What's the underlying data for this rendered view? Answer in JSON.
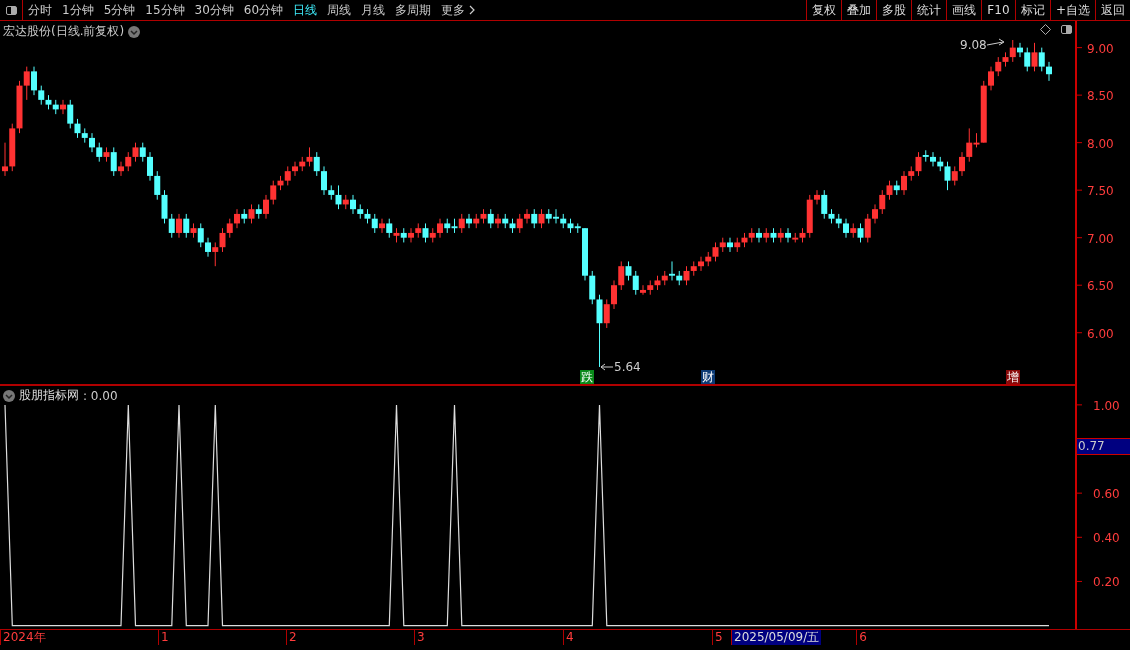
{
  "toolbar": {
    "periods": [
      {
        "label": "分时",
        "selected": false
      },
      {
        "label": "1分钟",
        "selected": false
      },
      {
        "label": "5分钟",
        "selected": false
      },
      {
        "label": "15分钟",
        "selected": false
      },
      {
        "label": "30分钟",
        "selected": false
      },
      {
        "label": "60分钟",
        "selected": false
      },
      {
        "label": "日线",
        "selected": true
      },
      {
        "label": "周线",
        "selected": false
      },
      {
        "label": "月线",
        "selected": false
      },
      {
        "label": "多周期",
        "selected": false
      },
      {
        "label": "更多",
        "selected": false
      }
    ],
    "actions": [
      "复权",
      "叠加",
      "多股",
      "统计",
      "画线",
      "F10",
      "标记",
      "+自选",
      "返回"
    ]
  },
  "price_panel": {
    "title": "宏达股份(日线.前复权)",
    "high_label": "9.08",
    "low_label": "5.64",
    "markers": [
      {
        "label": "跌",
        "color": "#0a8a1a"
      },
      {
        "label": "财",
        "color": "#0c3a74"
      },
      {
        "label": "增",
        "color": "#8a0a0a"
      }
    ],
    "chart_data": {
      "type": "candlestick",
      "ylim": [
        5.45,
        9.28
      ],
      "categories": [
        null,
        null,
        null,
        null,
        null,
        null,
        null,
        null,
        null,
        null,
        null,
        null,
        null,
        null,
        null,
        null,
        null,
        null,
        null,
        null,
        null,
        null,
        null,
        null,
        null,
        null,
        null,
        null,
        null,
        null,
        null,
        null,
        null,
        null,
        null,
        null,
        null,
        null,
        null,
        null,
        null,
        null,
        null,
        null,
        null,
        null,
        null,
        null,
        null,
        null,
        null,
        null,
        null,
        null,
        null,
        null,
        null,
        null,
        null,
        null,
        null,
        null,
        null,
        null,
        null,
        null,
        null,
        null,
        null,
        null,
        null,
        null,
        null,
        null,
        null,
        null,
        null,
        null,
        null,
        null,
        null,
        null,
        null,
        null,
        null,
        null,
        null,
        null,
        null,
        null,
        null,
        null,
        null,
        null,
        null,
        null,
        null,
        null,
        null,
        null,
        null,
        null,
        null,
        null,
        null,
        null,
        null,
        null,
        null,
        null,
        null,
        null,
        null,
        null,
        null,
        null,
        null,
        null,
        null,
        null,
        null,
        null,
        null,
        null,
        null,
        null,
        null,
        null,
        null,
        null,
        null,
        null,
        null,
        null,
        null,
        null,
        null,
        null,
        null,
        null,
        null,
        null,
        null,
        null,
        null
      ],
      "yticks": [
        {
          "value": 9,
          "label": "9.00"
        },
        {
          "value": 8.5,
          "label": "8.50"
        },
        {
          "value": 8,
          "label": "8.00"
        },
        {
          "value": 7.5,
          "label": "7.50"
        },
        {
          "value": 7,
          "label": "7.00"
        },
        {
          "value": 6.5,
          "label": "6.50"
        },
        {
          "value": 6,
          "label": "6.00"
        }
      ],
      "ohlc": [
        [
          7.7,
          8.0,
          7.65,
          7.75
        ],
        [
          7.75,
          8.2,
          7.7,
          8.15
        ],
        [
          8.15,
          8.65,
          8.1,
          8.6
        ],
        [
          8.6,
          8.8,
          8.45,
          8.75
        ],
        [
          8.75,
          8.8,
          8.5,
          8.55
        ],
        [
          8.55,
          8.6,
          8.4,
          8.45
        ],
        [
          8.45,
          8.5,
          8.35,
          8.4
        ],
        [
          8.4,
          8.45,
          8.3,
          8.35
        ],
        [
          8.35,
          8.45,
          8.3,
          8.4
        ],
        [
          8.4,
          8.45,
          8.15,
          8.2
        ],
        [
          8.2,
          8.25,
          8.05,
          8.1
        ],
        [
          8.1,
          8.15,
          8.0,
          8.05
        ],
        [
          8.05,
          8.1,
          7.9,
          7.95
        ],
        [
          7.95,
          8.0,
          7.8,
          7.85
        ],
        [
          7.85,
          7.95,
          7.8,
          7.9
        ],
        [
          7.9,
          7.95,
          7.65,
          7.7
        ],
        [
          7.7,
          7.8,
          7.65,
          7.75
        ],
        [
          7.75,
          7.9,
          7.7,
          7.85
        ],
        [
          7.85,
          8.0,
          7.8,
          7.95
        ],
        [
          7.95,
          8.0,
          7.8,
          7.85
        ],
        [
          7.85,
          7.9,
          7.6,
          7.65
        ],
        [
          7.65,
          7.7,
          7.4,
          7.45
        ],
        [
          7.45,
          7.5,
          7.15,
          7.2
        ],
        [
          7.2,
          7.25,
          7.0,
          7.05
        ],
        [
          7.05,
          7.25,
          7.0,
          7.2
        ],
        [
          7.2,
          7.25,
          7.0,
          7.05
        ],
        [
          7.05,
          7.15,
          7.0,
          7.1
        ],
        [
          7.1,
          7.15,
          6.9,
          6.95
        ],
        [
          6.95,
          7.0,
          6.8,
          6.85
        ],
        [
          6.85,
          6.95,
          6.7,
          6.9
        ],
        [
          6.9,
          7.1,
          6.85,
          7.05
        ],
        [
          7.05,
          7.2,
          7.0,
          7.15
        ],
        [
          7.15,
          7.3,
          7.1,
          7.25
        ],
        [
          7.25,
          7.3,
          7.15,
          7.2
        ],
        [
          7.2,
          7.35,
          7.15,
          7.3
        ],
        [
          7.3,
          7.35,
          7.2,
          7.25
        ],
        [
          7.25,
          7.45,
          7.2,
          7.4
        ],
        [
          7.4,
          7.6,
          7.35,
          7.55
        ],
        [
          7.55,
          7.65,
          7.5,
          7.6
        ],
        [
          7.6,
          7.75,
          7.55,
          7.7
        ],
        [
          7.7,
          7.8,
          7.65,
          7.75
        ],
        [
          7.75,
          7.85,
          7.7,
          7.8
        ],
        [
          7.8,
          7.95,
          7.75,
          7.85
        ],
        [
          7.85,
          7.9,
          7.65,
          7.7
        ],
        [
          7.7,
          7.75,
          7.45,
          7.5
        ],
        [
          7.5,
          7.55,
          7.4,
          7.45
        ],
        [
          7.45,
          7.55,
          7.3,
          7.35
        ],
        [
          7.35,
          7.45,
          7.3,
          7.4
        ],
        [
          7.4,
          7.45,
          7.25,
          7.3
        ],
        [
          7.3,
          7.35,
          7.2,
          7.25
        ],
        [
          7.25,
          7.3,
          7.15,
          7.2
        ],
        [
          7.2,
          7.25,
          7.05,
          7.1
        ],
        [
          7.1,
          7.2,
          7.05,
          7.15
        ],
        [
          7.15,
          7.2,
          7.0,
          7.05
        ],
        [
          7.02,
          7.1,
          6.95,
          7.05
        ],
        [
          7.05,
          7.1,
          6.95,
          7.0
        ],
        [
          7.0,
          7.1,
          6.95,
          7.05
        ],
        [
          7.05,
          7.15,
          7.0,
          7.1
        ],
        [
          7.1,
          7.15,
          6.95,
          7.0
        ],
        [
          7.0,
          7.1,
          6.95,
          7.05
        ],
        [
          7.05,
          7.2,
          7.0,
          7.15
        ],
        [
          7.15,
          7.2,
          7.05,
          7.1
        ],
        [
          7.12,
          7.2,
          7.05,
          7.1
        ],
        [
          7.1,
          7.25,
          7.05,
          7.2
        ],
        [
          7.2,
          7.25,
          7.1,
          7.15
        ],
        [
          7.15,
          7.25,
          7.1,
          7.2
        ],
        [
          7.2,
          7.3,
          7.15,
          7.25
        ],
        [
          7.25,
          7.3,
          7.1,
          7.15
        ],
        [
          7.15,
          7.25,
          7.1,
          7.2
        ],
        [
          7.2,
          7.25,
          7.1,
          7.15
        ],
        [
          7.15,
          7.2,
          7.05,
          7.1
        ],
        [
          7.1,
          7.25,
          7.05,
          7.2
        ],
        [
          7.2,
          7.3,
          7.15,
          7.25
        ],
        [
          7.25,
          7.3,
          7.1,
          7.15
        ],
        [
          7.15,
          7.3,
          7.1,
          7.25
        ],
        [
          7.25,
          7.3,
          7.15,
          7.2
        ],
        [
          7.22,
          7.3,
          7.15,
          7.2
        ],
        [
          7.2,
          7.25,
          7.1,
          7.15
        ],
        [
          7.15,
          7.2,
          7.05,
          7.1
        ],
        [
          7.12,
          7.15,
          7.05,
          7.1
        ],
        [
          7.1,
          7.1,
          6.55,
          6.6
        ],
        [
          6.6,
          6.65,
          6.3,
          6.35
        ],
        [
          6.35,
          6.4,
          5.64,
          6.1
        ],
        [
          6.1,
          6.35,
          6.05,
          6.3
        ],
        [
          6.3,
          6.55,
          6.25,
          6.5
        ],
        [
          6.5,
          6.75,
          6.45,
          6.7
        ],
        [
          6.7,
          6.75,
          6.55,
          6.6
        ],
        [
          6.6,
          6.65,
          6.4,
          6.45
        ],
        [
          6.42,
          6.5,
          6.4,
          6.45
        ],
        [
          6.45,
          6.55,
          6.4,
          6.5
        ],
        [
          6.5,
          6.6,
          6.45,
          6.55
        ],
        [
          6.55,
          6.65,
          6.5,
          6.6
        ],
        [
          6.62,
          6.75,
          6.55,
          6.6
        ],
        [
          6.6,
          6.65,
          6.5,
          6.55
        ],
        [
          6.55,
          6.7,
          6.5,
          6.65
        ],
        [
          6.65,
          6.75,
          6.6,
          6.7
        ],
        [
          6.7,
          6.8,
          6.65,
          6.75
        ],
        [
          6.75,
          6.85,
          6.7,
          6.8
        ],
        [
          6.8,
          6.95,
          6.75,
          6.9
        ],
        [
          6.9,
          7.0,
          6.85,
          6.95
        ],
        [
          6.95,
          7.0,
          6.85,
          6.9
        ],
        [
          6.9,
          7.0,
          6.85,
          6.95
        ],
        [
          6.95,
          7.05,
          6.9,
          7.0
        ],
        [
          7.0,
          7.1,
          6.95,
          7.05
        ],
        [
          7.05,
          7.1,
          6.95,
          7.0
        ],
        [
          7.0,
          7.1,
          6.95,
          7.05
        ],
        [
          7.05,
          7.1,
          6.95,
          7.0
        ],
        [
          7.0,
          7.1,
          6.95,
          7.05
        ],
        [
          7.05,
          7.1,
          6.95,
          7.0
        ],
        [
          6.98,
          7.05,
          6.95,
          7.0
        ],
        [
          7.0,
          7.1,
          6.95,
          7.05
        ],
        [
          7.05,
          7.45,
          7.0,
          7.4
        ],
        [
          7.4,
          7.5,
          7.35,
          7.45
        ],
        [
          7.45,
          7.5,
          7.2,
          7.25
        ],
        [
          7.25,
          7.3,
          7.15,
          7.2
        ],
        [
          7.2,
          7.25,
          7.1,
          7.15
        ],
        [
          7.15,
          7.2,
          7.0,
          7.05
        ],
        [
          7.05,
          7.15,
          7.0,
          7.1
        ],
        [
          7.1,
          7.15,
          6.95,
          7.0
        ],
        [
          7.0,
          7.25,
          6.95,
          7.2
        ],
        [
          7.2,
          7.35,
          7.15,
          7.3
        ],
        [
          7.3,
          7.5,
          7.25,
          7.45
        ],
        [
          7.45,
          7.6,
          7.4,
          7.55
        ],
        [
          7.55,
          7.6,
          7.45,
          7.5
        ],
        [
          7.5,
          7.7,
          7.45,
          7.65
        ],
        [
          7.65,
          7.75,
          7.6,
          7.7
        ],
        [
          7.7,
          7.9,
          7.65,
          7.85
        ],
        [
          7.87,
          7.92,
          7.8,
          7.85
        ],
        [
          7.85,
          7.9,
          7.75,
          7.8
        ],
        [
          7.8,
          7.85,
          7.7,
          7.75
        ],
        [
          7.75,
          7.8,
          7.5,
          7.6
        ],
        [
          7.6,
          7.75,
          7.55,
          7.7
        ],
        [
          7.7,
          7.9,
          7.65,
          7.85
        ],
        [
          7.85,
          8.15,
          7.8,
          8.0
        ],
        [
          7.98,
          8.1,
          7.95,
          8.0
        ],
        [
          8.0,
          8.65,
          8.0,
          8.6
        ],
        [
          8.6,
          8.8,
          8.55,
          8.75
        ],
        [
          8.75,
          8.9,
          8.7,
          8.85
        ],
        [
          8.85,
          8.95,
          8.8,
          8.9
        ],
        [
          8.9,
          9.08,
          8.85,
          9.0
        ],
        [
          9.0,
          9.05,
          8.9,
          8.95
        ],
        [
          8.95,
          9.0,
          8.75,
          8.8
        ],
        [
          8.8,
          9.05,
          8.75,
          8.95
        ],
        [
          8.95,
          9.0,
          8.75,
          8.8
        ],
        [
          8.8,
          8.85,
          8.65,
          8.72
        ]
      ]
    }
  },
  "indicator_panel": {
    "current_value": ": 0.00",
    "cursor_value": "0.77",
    "chart_data": {
      "type": "line",
      "ylim": [
        -0.02,
        1.09
      ],
      "categories": [
        null,
        null,
        null,
        null,
        null,
        null,
        null,
        null,
        null,
        null,
        null,
        null,
        null,
        null,
        null,
        null,
        null,
        null,
        null,
        null,
        null,
        null,
        null,
        null,
        null,
        null,
        null,
        null,
        null,
        null,
        null,
        null,
        null,
        null,
        null,
        null,
        null,
        null,
        null,
        null,
        null,
        null,
        null,
        null,
        null,
        null,
        null,
        null,
        null,
        null,
        null,
        null,
        null,
        null,
        null,
        null,
        null,
        null,
        null,
        null,
        null,
        null,
        null,
        null,
        null,
        null,
        null,
        null,
        null,
        null,
        null,
        null,
        null,
        null,
        null,
        null,
        null,
        null,
        null,
        null,
        null,
        null,
        null,
        null,
        null,
        null,
        null,
        null,
        null,
        null,
        null,
        null,
        null,
        null,
        null,
        null,
        null,
        null,
        null,
        null,
        null,
        null,
        null,
        null,
        null,
        null,
        null,
        null,
        null,
        null,
        null,
        null,
        null,
        null,
        null,
        null,
        null,
        null,
        null,
        null,
        null,
        null,
        null,
        null,
        null,
        null,
        null,
        null,
        null,
        null,
        null,
        null,
        null,
        null,
        null,
        null,
        null,
        null,
        null,
        null,
        null,
        null,
        null,
        null,
        null
      ],
      "yticks": [
        {
          "value": 1,
          "label": "1.00"
        },
        {
          "value": 0.6,
          "label": "0.60"
        },
        {
          "value": 0.4,
          "label": "0.40"
        },
        {
          "value": 0.2,
          "label": "0.20"
        }
      ],
      "series": [
        {
          "name": "股朋指标网",
          "color": "#dddddd",
          "values": [
            1,
            0,
            0,
            0,
            0,
            0,
            0,
            0,
            0,
            0,
            0,
            0,
            0,
            0,
            0,
            0,
            0,
            1,
            0,
            0,
            0,
            0,
            0,
            0,
            1,
            0,
            0,
            0,
            0,
            1,
            0,
            0,
            0,
            0,
            0,
            0,
            0,
            0,
            0,
            0,
            0,
            0,
            0,
            0,
            0,
            0,
            0,
            0,
            0,
            0,
            0,
            0,
            0,
            0,
            1,
            0,
            0,
            0,
            0,
            0,
            0,
            0,
            1,
            0,
            0,
            0,
            0,
            0,
            0,
            0,
            0,
            0,
            0,
            0,
            0,
            0,
            0,
            0,
            0,
            0,
            0,
            0,
            1,
            0,
            0,
            0,
            0,
            0,
            0,
            0,
            0,
            0,
            0,
            0,
            0,
            0,
            0,
            0,
            0,
            0,
            0,
            0,
            0,
            0,
            0,
            0,
            0,
            0,
            0,
            0,
            0,
            0,
            0,
            0,
            0,
            0,
            0,
            0,
            0,
            0,
            0,
            0,
            0,
            0,
            0,
            0,
            0,
            0,
            0,
            0,
            0,
            0,
            0,
            0,
            0,
            0,
            0,
            0,
            0,
            0,
            0,
            0,
            0,
            0,
            0
          ]
        }
      ]
    }
  },
  "time_axis": [
    {
      "label": "2024年",
      "kind": "tick"
    },
    {
      "label": "1",
      "kind": "tick"
    },
    {
      "label": "2",
      "kind": "tick"
    },
    {
      "label": "3",
      "kind": "tick"
    },
    {
      "label": "4",
      "kind": "tick"
    },
    {
      "label": "5",
      "kind": "tick"
    },
    {
      "label": "2025/05/09/五",
      "kind": "cursor"
    },
    {
      "label": "6",
      "kind": "tick"
    }
  ]
}
